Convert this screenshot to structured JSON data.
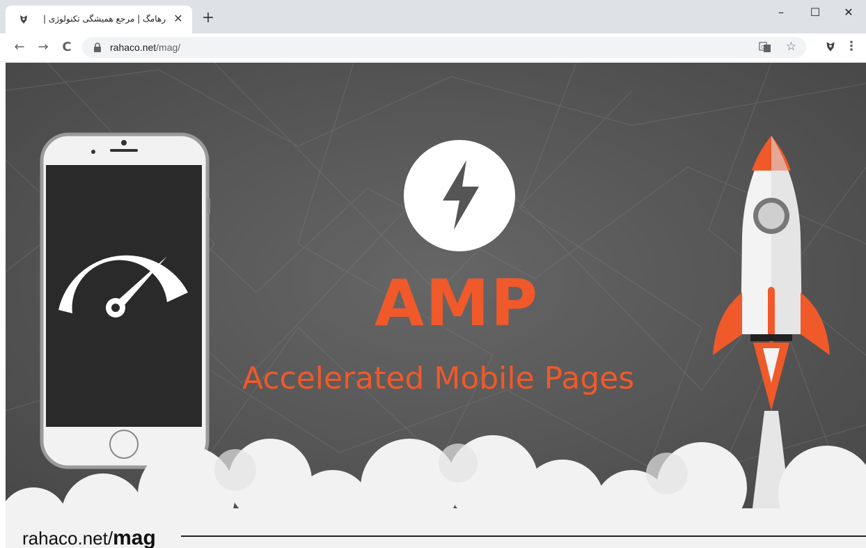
{
  "browser": {
    "tab_title": "رهامگ | مرجع همیشگی تکنولوژی |",
    "close_glyph": "✕",
    "new_tab_glyph": "+",
    "window": {
      "minimize": "–",
      "maximize": "☐",
      "close": "✕"
    },
    "nav": {
      "back": "←",
      "forward": "→",
      "reload": "C"
    },
    "url_host": "rahaco.net",
    "url_path": "/mag/",
    "star_glyph": "☆",
    "menu_glyph": "⋮"
  },
  "hero": {
    "title": "AMP",
    "subtitle": "Accelerated Mobile Pages",
    "caption_domain": "rahaco.net/",
    "caption_path": "mag",
    "accent_color": "#f0592a",
    "background_color": "#5d5d5d",
    "icons": [
      "lightning-bolt-icon",
      "speedometer-icon",
      "rocket-icon",
      "smartphone-icon"
    ]
  }
}
